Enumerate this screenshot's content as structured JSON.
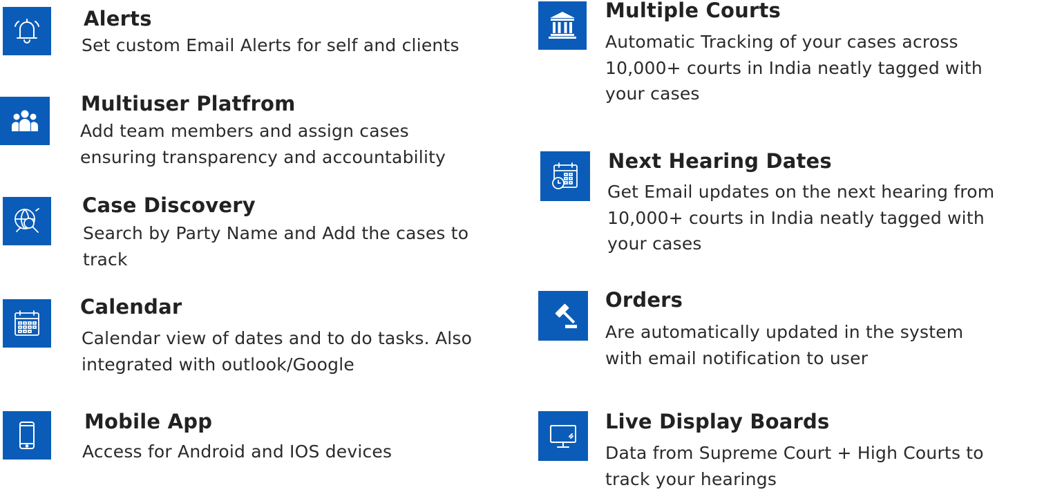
{
  "theme": {
    "icon_bg": "#0b5cb8",
    "text": "#222222"
  },
  "features": {
    "alerts": {
      "icon": "bell-icon",
      "title": "Alerts",
      "desc": [
        "Set custom Email Alerts for self and clients"
      ]
    },
    "multiuser": {
      "icon": "team-icon",
      "title": "Multiuser Platfrom",
      "desc": [
        "Add  team members and assign cases",
        "ensuring transparency and accountability"
      ]
    },
    "discovery": {
      "icon": "globe-search-icon",
      "title": "Case Discovery",
      "desc": [
        "Search by Party Name and Add the cases to",
        "track"
      ]
    },
    "calendar": {
      "icon": "calendar-icon",
      "title": "Calendar",
      "desc": [
        "Calendar view of dates and to do tasks. Also",
        "integrated with outlook/Google"
      ]
    },
    "mobile": {
      "icon": "smartphone-icon",
      "title": "Mobile App",
      "desc": [
        "Access for Android and IOS devices"
      ]
    },
    "courts": {
      "icon": "courthouse-icon",
      "title": "Multiple Courts",
      "desc": [
        "Automatic Tracking of your cases across",
        "10,000+ courts in India neatly tagged with",
        "your cases"
      ]
    },
    "hearing": {
      "icon": "calendar-clock-icon",
      "title": "Next Hearing Dates",
      "desc": [
        "Get Email updates on the next hearing from",
        "10,000+ courts in India neatly tagged with",
        "your cases"
      ]
    },
    "orders": {
      "icon": "gavel-icon",
      "title": "Orders",
      "desc": [
        "Are automatically updated in the system",
        "with email notification to user"
      ]
    },
    "display": {
      "icon": "monitor-icon",
      "title": "Live Display Boards",
      "desc": [
        "Data from Supreme Court + High Courts to",
        "track your hearings"
      ]
    }
  }
}
